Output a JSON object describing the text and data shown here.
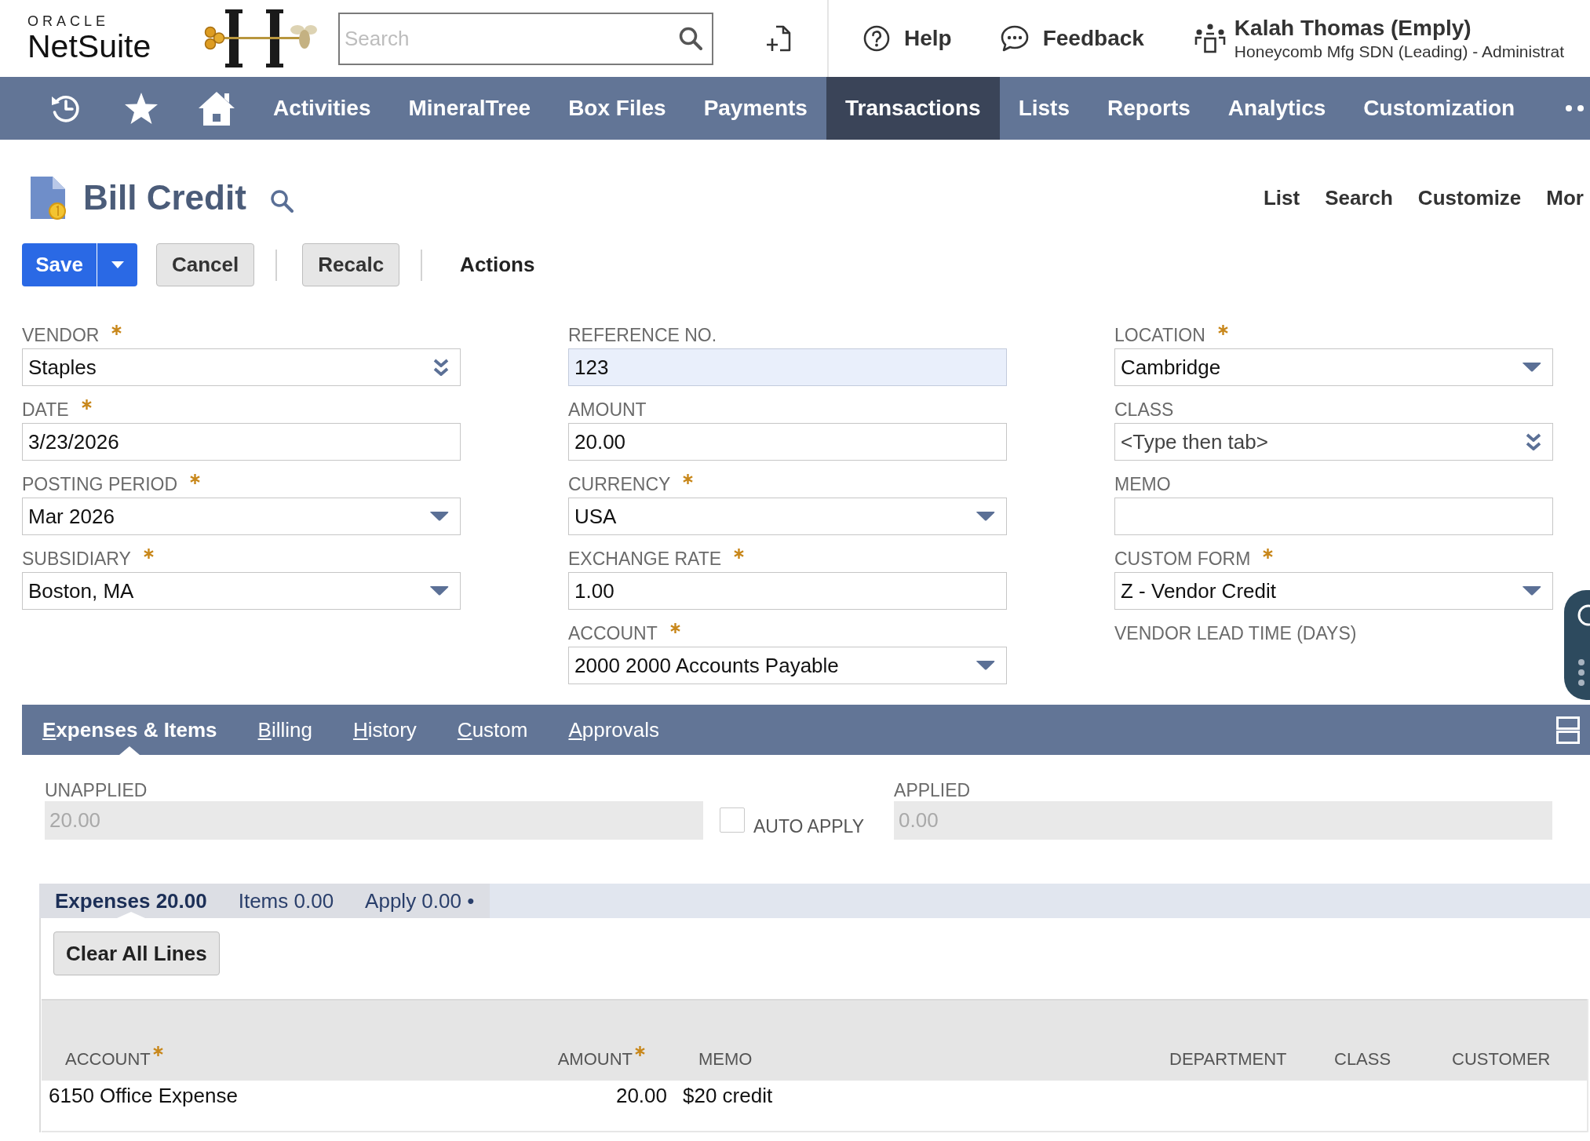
{
  "header": {
    "logo": {
      "caption": "ORACLE",
      "wordmark": "NetSuite"
    },
    "search": {
      "placeholder": "Search"
    },
    "links": [
      {
        "kind": "help",
        "label": "Help"
      },
      {
        "kind": "feedback",
        "label": "Feedback"
      }
    ],
    "user": {
      "name": "Kalah Thomas (Emply)",
      "role": "Honeycomb Mfg SDN (Leading) - Administrat"
    }
  },
  "nav": {
    "items": [
      {
        "label": "Activities",
        "selected": false
      },
      {
        "label": "MineralTree",
        "selected": false
      },
      {
        "label": "Box Files",
        "selected": false
      },
      {
        "label": "Payments",
        "selected": false
      },
      {
        "label": "Transactions",
        "selected": true
      },
      {
        "label": "Lists",
        "selected": false
      },
      {
        "label": "Reports",
        "selected": false
      },
      {
        "label": "Analytics",
        "selected": false
      },
      {
        "label": "Customization",
        "selected": false
      }
    ]
  },
  "page": {
    "title": "Bill Credit",
    "links": [
      "List",
      "Search",
      "Customize",
      "Mor"
    ]
  },
  "actions": [
    {
      "kind": "primary",
      "label": "Save"
    },
    {
      "kind": "secondary",
      "label": "Cancel"
    },
    {
      "kind": "secondary",
      "label": "Recalc"
    },
    {
      "kind": "menu",
      "label": "Actions"
    }
  ],
  "form": {
    "columns": [
      {
        "fields": [
          {
            "label": "VENDOR",
            "required": true,
            "kind": "autocomplete",
            "value": "Staples",
            "focused": false
          },
          {
            "label": "DATE",
            "required": true,
            "kind": "text",
            "value": "3/23/2026",
            "focused": false
          },
          {
            "label": "POSTING PERIOD",
            "required": true,
            "kind": "select",
            "value": "Mar 2026",
            "focused": false
          },
          {
            "label": "SUBSIDIARY",
            "required": true,
            "kind": "select",
            "value": "Boston, MA",
            "focused": false
          }
        ]
      },
      {
        "fields": [
          {
            "label": "REFERENCE NO.",
            "required": false,
            "kind": "text",
            "value": "123",
            "focused": true
          },
          {
            "label": "AMOUNT",
            "required": false,
            "kind": "text",
            "value": "20.00",
            "focused": false
          },
          {
            "label": "CURRENCY",
            "required": true,
            "kind": "select",
            "value": "USA",
            "focused": false
          },
          {
            "label": "EXCHANGE RATE",
            "required": true,
            "kind": "text",
            "value": "1.00",
            "focused": false
          },
          {
            "label": "ACCOUNT",
            "required": true,
            "kind": "select",
            "value": "2000 2000 Accounts Payable",
            "focused": false
          }
        ]
      },
      {
        "fields": [
          {
            "label": "LOCATION",
            "required": true,
            "kind": "select",
            "value": "Cambridge",
            "focused": false
          },
          {
            "label": "CLASS",
            "required": false,
            "kind": "autocomplete",
            "placeholder": "<Type then tab>",
            "focused": false
          },
          {
            "label": "MEMO",
            "required": false,
            "kind": "text",
            "focused": false
          },
          {
            "label": "CUSTOM FORM",
            "required": true,
            "kind": "select",
            "value": "Z - Vendor Credit",
            "focused": false
          },
          {
            "label": "VENDOR LEAD TIME (DAYS)",
            "required": false,
            "kind": "display"
          }
        ]
      }
    ]
  },
  "subtabs": {
    "items": [
      {
        "label": "Expenses & Items",
        "selected": true
      },
      {
        "label": "Billing",
        "selected": false
      },
      {
        "label": "History",
        "selected": false
      },
      {
        "label": "Custom",
        "selected": false
      },
      {
        "label": "Approvals",
        "selected": false
      }
    ]
  },
  "apply": {
    "unapplied": {
      "label": "UNAPPLIED",
      "value": "20.00"
    },
    "auto_apply": {
      "label": "AUTO APPLY",
      "checked": false
    },
    "applied": {
      "label": "APPLIED",
      "value": "0.00"
    }
  },
  "lines": {
    "tabs": [
      {
        "label": "Expenses 20.00",
        "selected": true
      },
      {
        "label": "Items 0.00",
        "selected": false
      },
      {
        "label": "Apply 0.00 •",
        "selected": false
      }
    ],
    "clear_button": "Clear All Lines",
    "table": {
      "columns": [
        {
          "label": "ACCOUNT",
          "required": true,
          "kind": "text"
        },
        {
          "label": "AMOUNT",
          "required": true,
          "kind": "number"
        },
        {
          "label": "MEMO",
          "required": false,
          "kind": "text"
        },
        {
          "label": "DEPARTMENT",
          "required": false,
          "kind": "text"
        },
        {
          "label": "CLASS",
          "required": false,
          "kind": "text"
        },
        {
          "label": "CUSTOMER",
          "required": false,
          "kind": "text"
        }
      ],
      "rows": [
        [
          "6150 Office Expense",
          "20.00",
          "$20 credit"
        ]
      ]
    }
  }
}
